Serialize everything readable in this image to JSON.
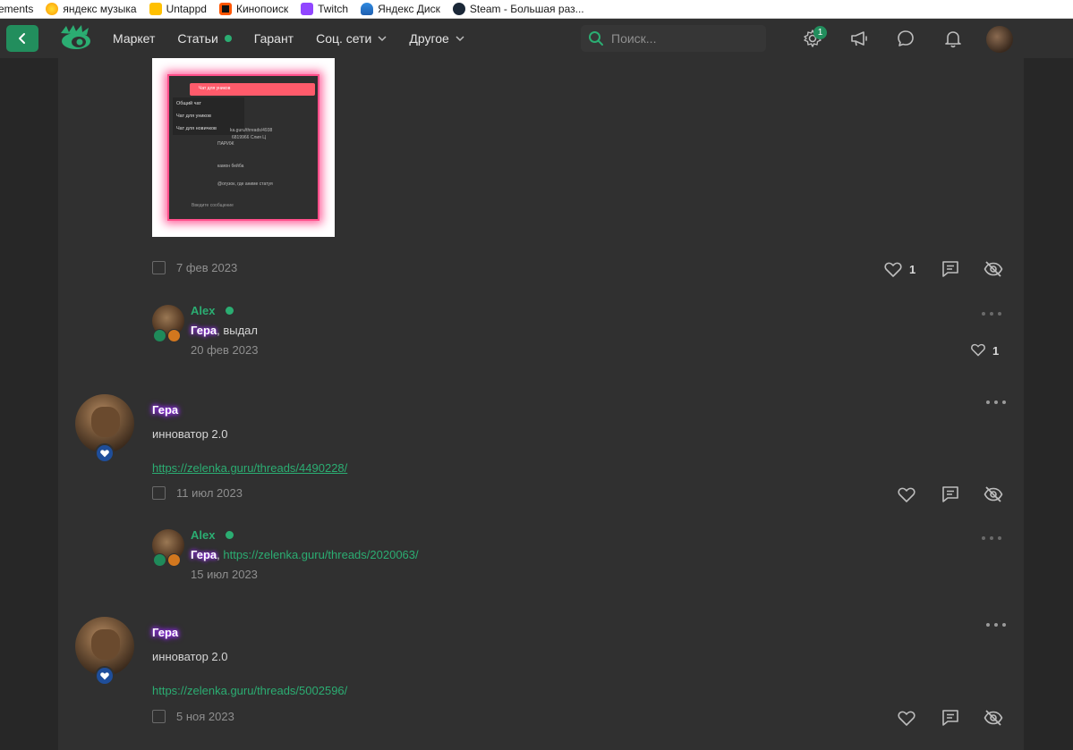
{
  "bookmarks": [
    {
      "label": "ements",
      "color": "transparent"
    },
    {
      "label": "яндекс музыка",
      "color": "#ffcc00"
    },
    {
      "label": "Untappd",
      "color": "#ffc000"
    },
    {
      "label": "Кинопоиск",
      "color": "#ff5500"
    },
    {
      "label": "Twitch",
      "color": "#9146ff"
    },
    {
      "label": "Яндекс Диск",
      "color": "#2f8ae0"
    },
    {
      "label": "Steam - Большая раз...",
      "color": "#1b2838"
    }
  ],
  "nav": {
    "items": [
      {
        "label": "Маркет"
      },
      {
        "label": "Статьи"
      },
      {
        "label": "Гарант"
      },
      {
        "label": "Соц. сети"
      },
      {
        "label": "Другое"
      }
    ],
    "search_placeholder": "Поиск...",
    "settings_badge": "1"
  },
  "attachment": {
    "bar_title": "Чат для уников",
    "menu": [
      "Общий чат",
      "Чат для уников",
      "Чат для новичков"
    ],
    "line1": "ka.guru/threads/4938",
    "line2": "6819966 Слия Ц",
    "line3": "ПАРИЖ",
    "line4": "камон бейба",
    "line5": "@огузок, где аниме статуя",
    "footer": "Введите сообщение"
  },
  "posts": [
    {
      "date": "7 фев 2023",
      "likes": "1",
      "comment": {
        "author": "Alex",
        "mention": "Гера",
        "text": ", выдал",
        "date": "20 фев 2023",
        "likes": "1"
      }
    },
    {
      "author": "Гера",
      "text": "инноватор 2.0",
      "link": "https://zelenka.guru/threads/4490228/",
      "date": "11 июл 2023",
      "comment": {
        "author": "Alex",
        "mention": "Гера",
        "sep": ", ",
        "link": "https://zelenka.guru/threads/2020063/",
        "date": "15 июл 2023"
      }
    },
    {
      "author": "Гера",
      "text": "инноватор 2.0",
      "link": "https://zelenka.guru/threads/5002596/",
      "date": "5 ноя 2023"
    }
  ],
  "colors": {
    "accent": "#2bad72",
    "button": "#228e5d",
    "background": "#272727",
    "panel": "#303030",
    "username_glow": "#8a2be2"
  }
}
